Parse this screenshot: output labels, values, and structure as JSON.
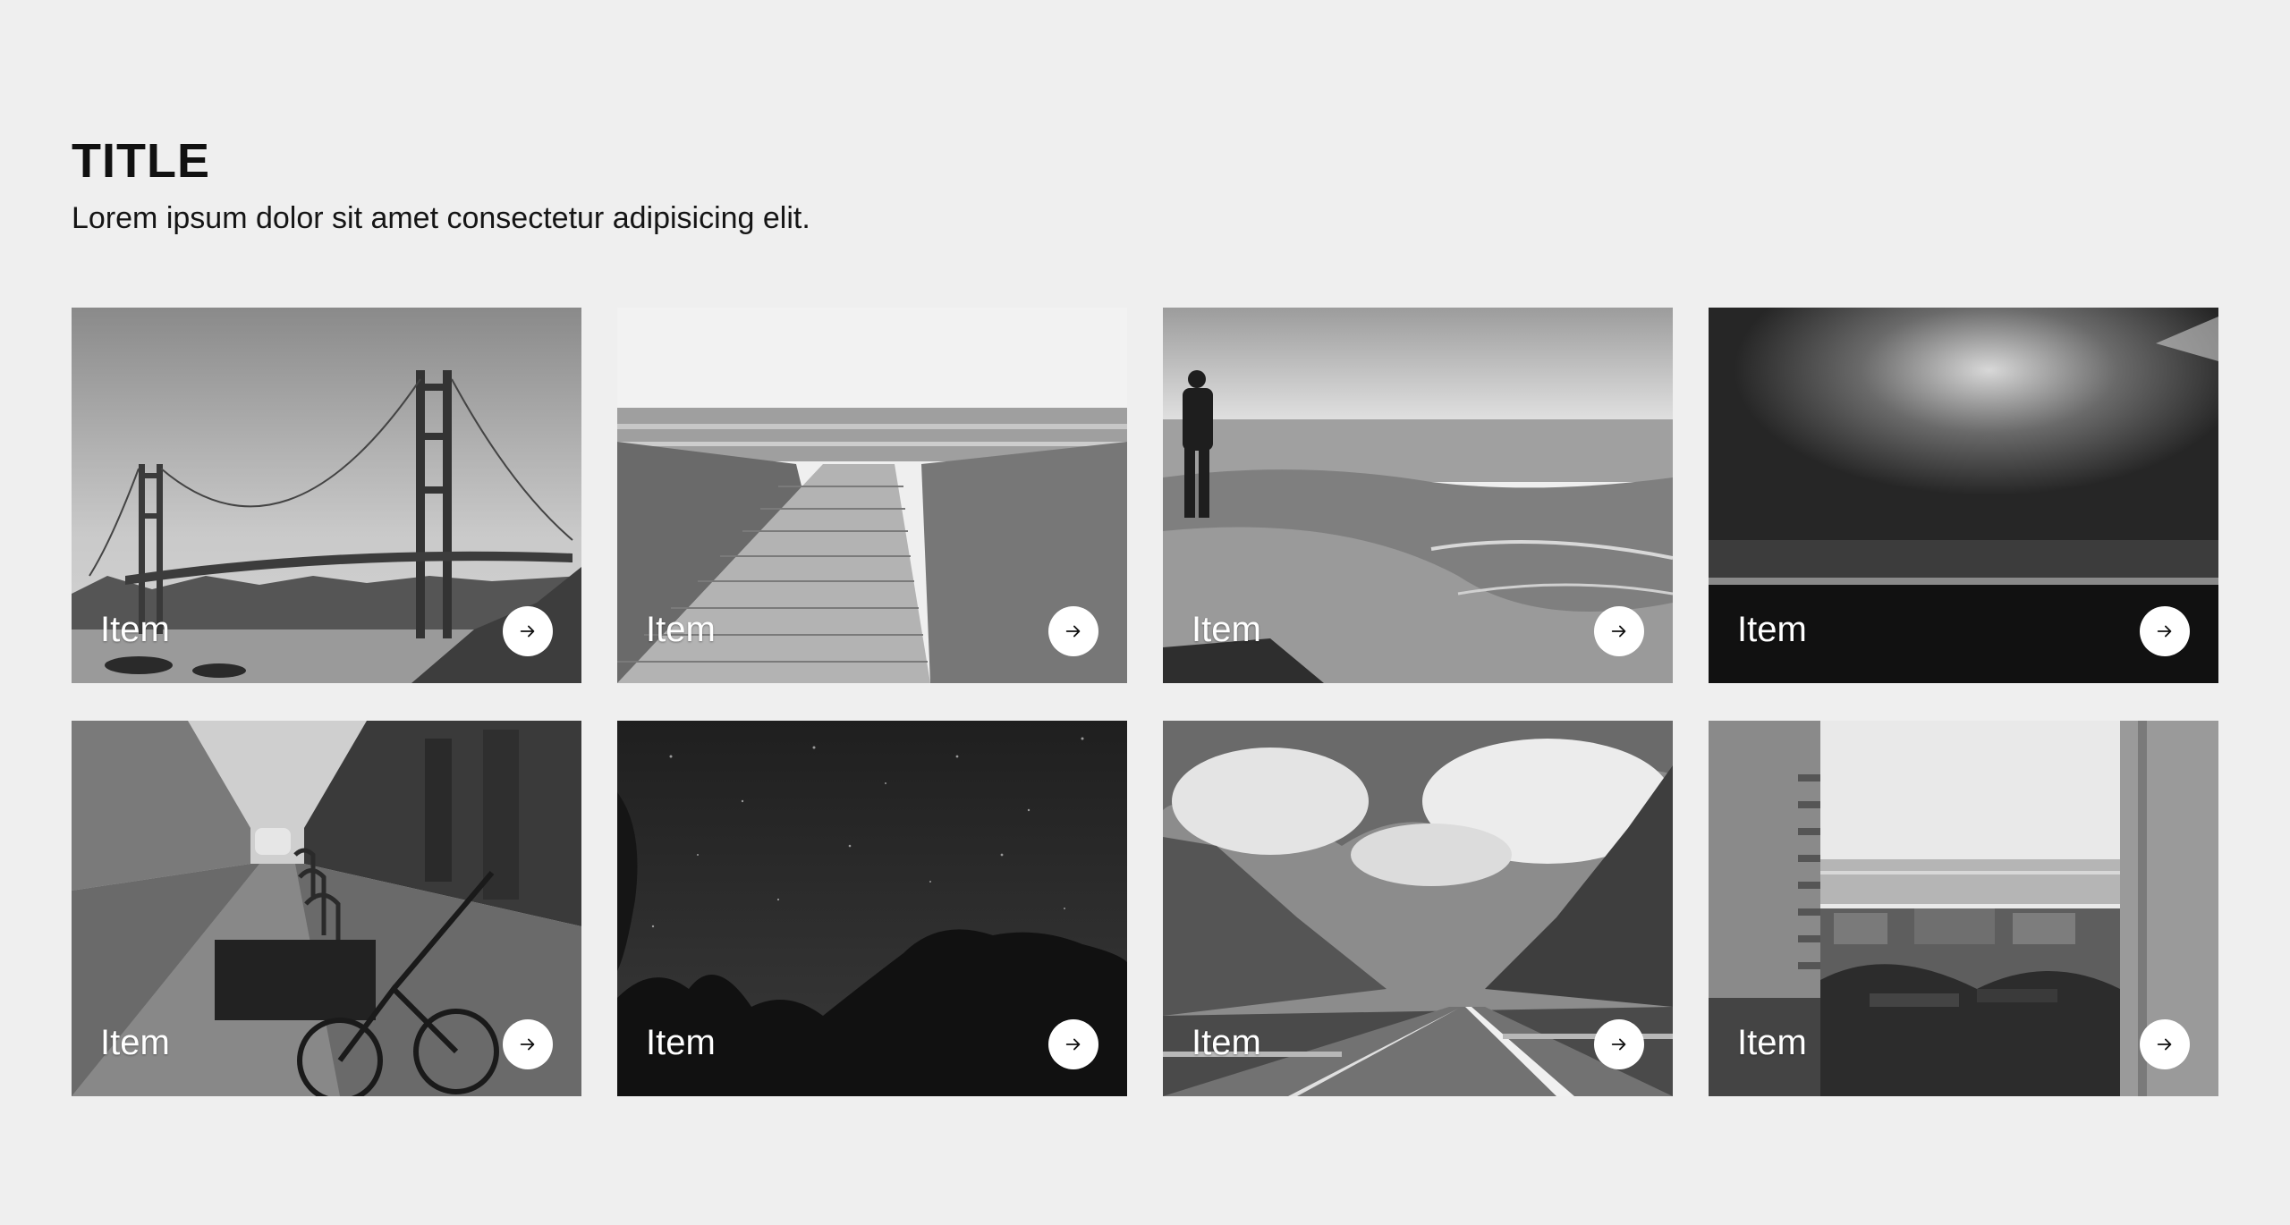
{
  "header": {
    "title": "TITLE",
    "subtitle": "Lorem ipsum dolor sit amet consectetur adipisicing elit."
  },
  "cards": [
    {
      "label": "Item",
      "image": "golden-gate-bridge",
      "icon": "arrow-right-icon"
    },
    {
      "label": "Item",
      "image": "boardwalk-to-sea",
      "icon": "arrow-right-icon"
    },
    {
      "label": "Item",
      "image": "man-by-waves",
      "icon": "arrow-right-icon"
    },
    {
      "label": "Item",
      "image": "stormy-sky-sea",
      "icon": "arrow-right-icon"
    },
    {
      "label": "Item",
      "image": "street-with-bicycles",
      "icon": "arrow-right-icon"
    },
    {
      "label": "Item",
      "image": "starry-night-trees",
      "icon": "arrow-right-icon"
    },
    {
      "label": "Item",
      "image": "mountain-road",
      "icon": "arrow-right-icon"
    },
    {
      "label": "Item",
      "image": "coastal-city-buildings",
      "icon": "arrow-right-icon"
    }
  ],
  "colors": {
    "background": "#efefef",
    "text": "#111111",
    "label": "#ffffff",
    "button": "#ffffff"
  }
}
